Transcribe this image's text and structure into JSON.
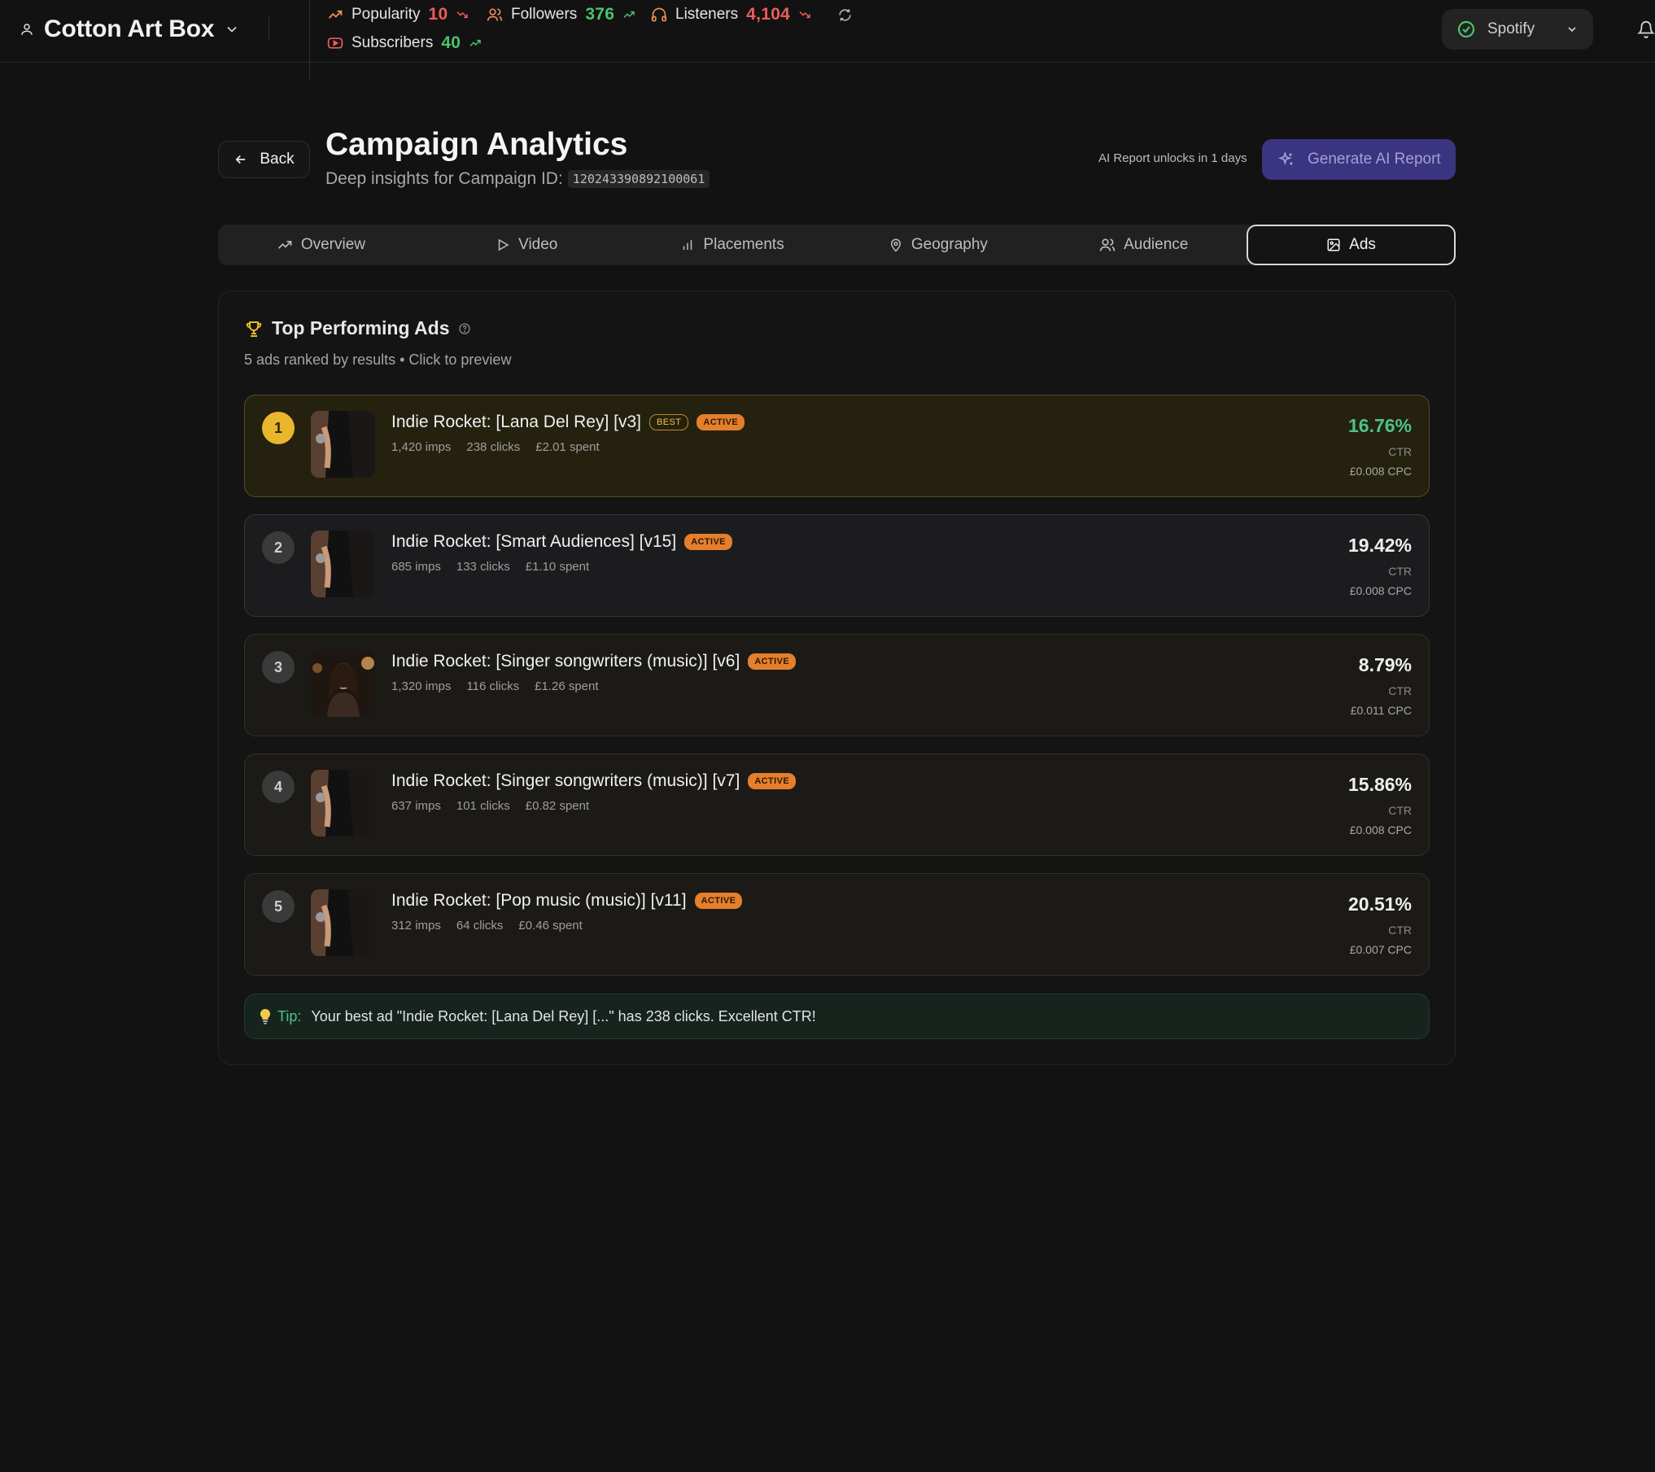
{
  "topbar": {
    "account_name": "Cotton Art Box",
    "metrics": {
      "popularity": {
        "label": "Popularity",
        "value": "10"
      },
      "followers": {
        "label": "Followers",
        "value": "376"
      },
      "listeners": {
        "label": "Listeners",
        "value": "4,104"
      },
      "subscribers": {
        "label": "Subscribers",
        "value": "40"
      }
    },
    "service": "Spotify"
  },
  "header": {
    "back_label": "Back",
    "title": "Campaign Analytics",
    "subtitle": "Deep insights for Campaign ID:",
    "campaign_id": "120243390892100061",
    "unlock_text": "AI Report unlocks in 1 days",
    "generate_label": "Generate AI Report"
  },
  "tabs": [
    {
      "label": "Overview"
    },
    {
      "label": "Video"
    },
    {
      "label": "Placements"
    },
    {
      "label": "Geography"
    },
    {
      "label": "Audience"
    },
    {
      "label": "Ads"
    }
  ],
  "top_ads": {
    "title": "Top Performing Ads",
    "subtitle": "5 ads ranked by results • Click to preview",
    "best_badge": "BEST",
    "active_badge": "ACTIVE",
    "ctr_label": "CTR",
    "ads": [
      {
        "rank": "1",
        "name": "Indie Rocket: [Lana Del Rey] [v3]",
        "imps": "1,420 imps",
        "clicks": "238 clicks",
        "spent": "£2.01 spent",
        "ctr": "16.76%",
        "cpc": "£0.008 CPC"
      },
      {
        "rank": "2",
        "name": "Indie Rocket: [Smart Audiences] [v15]",
        "imps": "685 imps",
        "clicks": "133 clicks",
        "spent": "£1.10 spent",
        "ctr": "19.42%",
        "cpc": "£0.008 CPC"
      },
      {
        "rank": "3",
        "name": "Indie Rocket: [Singer songwriters (music)] [v6]",
        "imps": "1,320 imps",
        "clicks": "116 clicks",
        "spent": "£1.26 spent",
        "ctr": "8.79%",
        "cpc": "£0.011 CPC"
      },
      {
        "rank": "4",
        "name": "Indie Rocket: [Singer songwriters (music)] [v7]",
        "imps": "637 imps",
        "clicks": "101 clicks",
        "spent": "£0.82 spent",
        "ctr": "15.86%",
        "cpc": "£0.008 CPC"
      },
      {
        "rank": "5",
        "name": "Indie Rocket: [Pop music (music)] [v11]",
        "imps": "312 imps",
        "clicks": "64 clicks",
        "spent": "£0.46 spent",
        "ctr": "20.51%",
        "cpc": "£0.007 CPC"
      }
    ]
  },
  "tip": {
    "label": "Tip:",
    "text": "Your best ad \"Indie Rocket: [Lana Del Rey] [...\" has 238 clicks. Excellent CTR!"
  },
  "colors": {
    "background": "#121212",
    "accent_purple": "#3b3480",
    "positive": "#4cc26c",
    "negative": "#ef5b5b",
    "gold": "#e9b62c",
    "active_badge": "#e57f2c"
  }
}
